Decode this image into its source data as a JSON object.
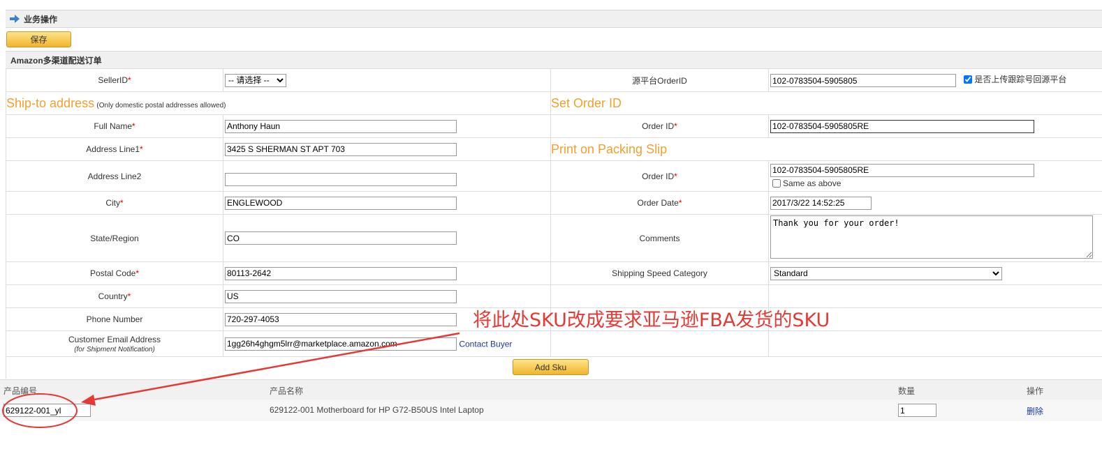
{
  "ops": {
    "title": "业务操作",
    "save_label": "保存"
  },
  "section": {
    "title": "Amazon多渠道配送订单"
  },
  "seller": {
    "label": "SellerID",
    "select_value": "-- 请选择 --"
  },
  "source_order": {
    "label": "源平台OrderID",
    "value": "102-0783504-5905805",
    "checkbox_label": "是否上传跟踪号回源平台",
    "checked": true
  },
  "ship_to": {
    "heading": "Ship-to address",
    "note": "(Only domestic postal addresses allowed)"
  },
  "set_order": {
    "heading": "Set Order ID"
  },
  "packing": {
    "heading": "Print on Packing Slip"
  },
  "fields": {
    "full_name": {
      "label": "Full Name",
      "value": "Anthony Haun"
    },
    "addr1": {
      "label": "Address Line1",
      "value": "3425 S SHERMAN ST APT 703"
    },
    "addr2": {
      "label": "Address Line2",
      "value": ""
    },
    "city": {
      "label": "City",
      "value": "ENGLEWOOD"
    },
    "state": {
      "label": "State/Region",
      "value": "CO"
    },
    "postal": {
      "label": "Postal Code",
      "value": "80113-2642"
    },
    "country": {
      "label": "Country",
      "value": "US"
    },
    "phone": {
      "label": "Phone Number",
      "value": "720-297-4053"
    },
    "email": {
      "label": "Customer Email Address",
      "sublabel": "(for Shipment Notification)",
      "value": "1gg26h4ghgm5lrr@marketplace.amazon.com",
      "link": "Contact Buyer"
    }
  },
  "order": {
    "order_id_label": "Order ID",
    "order_id_value": "102-0783504-5905805RE",
    "slip_order_id_label": "Order ID",
    "slip_order_id_value": "102-0783504-5905805RE",
    "same_as_above": "Same as above",
    "date_label": "Order Date",
    "date_value": "2017/3/22 14:52:25",
    "comments_label": "Comments",
    "comments_value": "Thank you for your order!",
    "speed_label": "Shipping Speed Category",
    "speed_value": "Standard"
  },
  "add_sku_label": "Add Sku",
  "products": {
    "headers": {
      "sku": "产品编号",
      "name": "产品名称",
      "qty": "数量",
      "op": "操作"
    },
    "rows": [
      {
        "sku": "629122-001_yl",
        "name": "629122-001 Motherboard for HP G72-B50US Intel Laptop",
        "qty": "1",
        "delete": "删除"
      }
    ]
  },
  "annotation": {
    "text": "将此处SKU改成要求亚马逊FBA发货的SKU",
    "color": "#e53935"
  },
  "colors": {
    "accent_orange": "#f0a030",
    "button_yellow": "#f1b52c",
    "required": "#dd0000"
  }
}
